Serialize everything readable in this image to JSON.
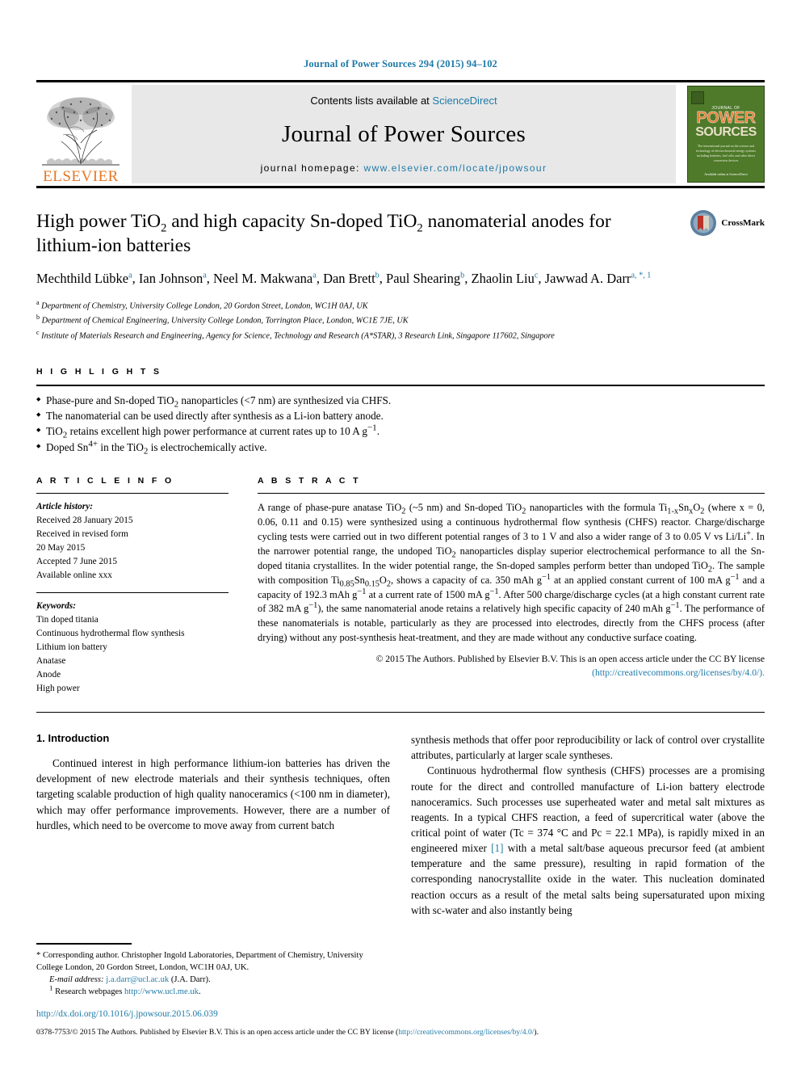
{
  "running_head": "Journal of Power Sources 294 (2015) 94–102",
  "masthead": {
    "contents_prefix": "Contents lists available at",
    "contents_link": "ScienceDirect",
    "journal_name": "Journal of Power Sources",
    "homepage_prefix": "journal homepage:",
    "homepage_url": "www.elsevier.com/locate/jpowsour",
    "publisher_logo_text": "ELSEVIER",
    "cover": {
      "journal_of": "JOURNAL OF",
      "power": "POWER",
      "sources": "SOURCES",
      "blurb": "The international journal on the science and technology of electrochemical energy systems including batteries, fuel cells and other direct conversion devices",
      "footer": "Available online at\nScienceDirect"
    }
  },
  "article": {
    "title_part1": "High power TiO",
    "title_sub1": "2",
    "title_part2": " and high capacity Sn-doped TiO",
    "title_sub2": "2",
    "title_part3": " nanomaterial anodes for lithium-ion batteries",
    "title_plain": "High power TiO2 and high capacity Sn-doped TiO2 nanomaterial anodes for lithium-ion batteries",
    "authors": [
      {
        "name": "Mechthild Lübke",
        "marks": "a"
      },
      {
        "name": "Ian Johnson",
        "marks": "a"
      },
      {
        "name": "Neel M. Makwana",
        "marks": "a"
      },
      {
        "name": "Dan Brett",
        "marks": "b"
      },
      {
        "name": "Paul Shearing",
        "marks": "b"
      },
      {
        "name": "Zhaolin Liu",
        "marks": "c"
      },
      {
        "name": "Jawwad A. Darr",
        "marks": "a, *, 1"
      }
    ],
    "affiliations": [
      {
        "mark": "a",
        "text": "Department of Chemistry, University College London, 20 Gordon Street, London, WC1H 0AJ, UK"
      },
      {
        "mark": "b",
        "text": "Department of Chemical Engineering, University College London, Torrington Place, London, WC1E 7JE, UK"
      },
      {
        "mark": "c",
        "text": "Institute of Materials Research and Engineering, Agency for Science, Technology and Research (A*STAR), 3 Research Link, Singapore 117602, Singapore"
      }
    ],
    "crossmark_label": "CrossMark"
  },
  "highlights": {
    "heading": "H I G H L I G H T S",
    "items": [
      "Phase-pure and Sn-doped TiO2 nanoparticles (<7 nm) are synthesized via CHFS.",
      "The nanomaterial can be used directly after synthesis as a Li-ion battery anode.",
      "TiO2 retains excellent high power performance at current rates up to 10 A g−1.",
      "Doped Sn4+ in the TiO2 is electrochemically active."
    ]
  },
  "article_info": {
    "heading": "A R T I C L E  I N F O",
    "history_label": "Article history:",
    "history": [
      "Received 28 January 2015",
      "Received in revised form",
      "20 May 2015",
      "Accepted 7 June 2015",
      "Available online xxx"
    ],
    "keywords_label": "Keywords:",
    "keywords": [
      "Tin doped titania",
      "Continuous hydrothermal flow synthesis",
      "Lithium ion battery",
      "Anatase",
      "Anode",
      "High power"
    ]
  },
  "abstract": {
    "heading": "A B S T R A C T",
    "text": "A range of phase-pure anatase TiO2 (~5 nm) and Sn-doped TiO2 nanoparticles with the formula Ti1-xSnxO2 (where x = 0, 0.06, 0.11 and 0.15) were synthesized using a continuous hydrothermal flow synthesis (CHFS) reactor. Charge/discharge cycling tests were carried out in two different potential ranges of 3 to 1 V and also a wider range of 3 to 0.05 V vs Li/Li+. In the narrower potential range, the undoped TiO2 nanoparticles display superior electrochemical performance to all the Sn-doped titania crystallites. In the wider potential range, the Sn-doped samples perform better than undoped TiO2. The sample with composition Ti0.85Sn0.15O2, shows a capacity of ca. 350 mAh g−1 at an applied constant current of 100 mA g−1 and a capacity of 192.3 mAh g−1 at a current rate of 1500 mA g−1. After 500 charge/discharge cycles (at a high constant current rate of 382 mA g−1), the same nanomaterial anode retains a relatively high specific capacity of 240 mAh g−1. The performance of these nanomaterials is notable, particularly as they are processed into electrodes, directly from the CHFS process (after drying) without any post-synthesis heat-treatment, and they are made without any conductive surface coating.",
    "copyright": "© 2015 The Authors. Published by Elsevier B.V. This is an open access article under the CC BY license",
    "license_url": "(http://creativecommons.org/licenses/by/4.0/)."
  },
  "body": {
    "section_number_title": "1. Introduction",
    "left_paragraphs": [
      "Continued interest in high performance lithium-ion batteries has driven the development of new electrode materials and their synthesis techniques, often targeting scalable production of high quality nanoceramics (<100 nm in diameter), which may offer performance improvements. However, there are a number of hurdles, which need to be overcome to move away from current batch"
    ],
    "right_paragraph_continued": "synthesis methods that offer poor reproducibility or lack of control over crystallite attributes, particularly at larger scale syntheses.",
    "right_paragraph_2_pre": "Continuous hydrothermal flow synthesis (CHFS) processes are a promising route for the direct and controlled manufacture of Li-ion battery electrode nanoceramics. Such processes use superheated water and metal salt mixtures as reagents. In a typical CHFS reaction, a feed of supercritical water (above the critical point of water (Tc = 374 °C and Pc = 22.1 MPa), is rapidly mixed in an engineered mixer ",
    "right_paragraph_2_ref": "[1]",
    "right_paragraph_2_post": " with a metal salt/base aqueous precursor feed (at ambient temperature and the same pressure), resulting in rapid formation of the corresponding nanocrystallite oxide in the water. This nucleation dominated reaction occurs as a result of the metal salts being supersaturated upon mixing with sc-water and also instantly being"
  },
  "footnotes": {
    "corresponding": "* Corresponding author. Christopher Ingold Laboratories, Department of Chemistry, University College London, 20 Gordon Street, London, WC1H 0AJ, UK.",
    "email_label": "E-mail address:",
    "email": "j.a.darr@ucl.ac.uk",
    "email_suffix": "(J.A. Darr).",
    "webpage_mark": "1",
    "webpage_label": "Research webpages",
    "webpage_url": "http://www.ucl.me.uk",
    "webpage_suffix": ".",
    "doi": "http://dx.doi.org/10.1016/j.jpowsour.2015.06.039",
    "legal_issn": "0378-7753/",
    "legal_text": "© 2015 The Authors. Published by Elsevier B.V. This is an open access article under the CC BY license (",
    "legal_link": "http://creativecommons.org/licenses/by/4.0/",
    "legal_tail": ")."
  },
  "colors": {
    "link": "#1f7aa8",
    "elsevier_orange": "#e77724",
    "cover_green": "#4e7a2a"
  }
}
